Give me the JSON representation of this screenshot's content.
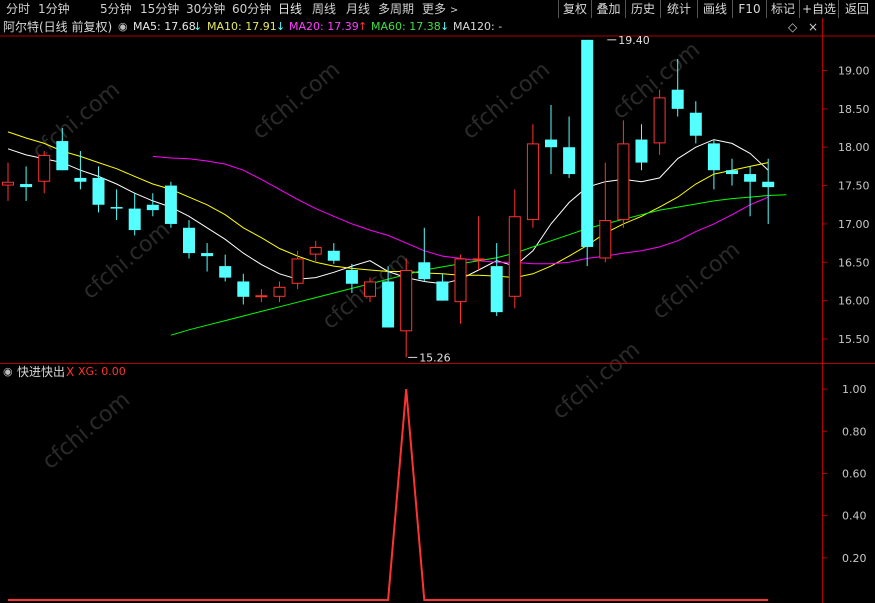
{
  "toolbar": {
    "periods": [
      "分时",
      "1分钟",
      "5分钟",
      "15分钟",
      "30分钟",
      "60分钟",
      "日线",
      "周线",
      "月线",
      "多周期",
      "更多"
    ],
    "right_buttons": [
      "复权",
      "叠加",
      "历史",
      "统计",
      "画线",
      "F10",
      "标记",
      "+自选",
      "返回"
    ]
  },
  "info": {
    "title": "阿尔特(日线 前复权)",
    "ma5": "MA5: 17.68",
    "ma10": "MA10: 17.91",
    "ma20": "MA20: 17.39",
    "ma60": "MA60: 17.38",
    "ma120": "MA120: -"
  },
  "indicator": {
    "name": "快进快出",
    "close_mark": "X",
    "value_label": "XG: 0.00"
  },
  "colors": {
    "up": "#ff3232",
    "down": "#54ffff",
    "ma5": "#ffffff",
    "ma10": "#ffff00",
    "ma20": "#ff00ff",
    "ma60": "#00ff00",
    "axis": "#b00000"
  },
  "watermark": "cfchi.com",
  "chart_data": [
    {
      "type": "candlestick",
      "title": "阿尔特(日线 前复权)",
      "ylim": [
        15.2,
        19.45
      ],
      "yticks": [
        "15.50",
        "16.00",
        "16.50",
        "17.00",
        "17.50",
        "18.00",
        "18.50",
        "19.00"
      ],
      "annotations": [
        {
          "text": "19.40",
          "candle": 33,
          "price": 19.4
        },
        {
          "text": "15.26",
          "candle": 22,
          "price": 15.26
        }
      ],
      "candles": [
        {
          "o": 17.5,
          "h": 17.8,
          "l": 17.3,
          "c": 17.55
        },
        {
          "o": 17.52,
          "h": 17.75,
          "l": 17.3,
          "c": 17.48
        },
        {
          "o": 17.55,
          "h": 17.95,
          "l": 17.4,
          "c": 17.9
        },
        {
          "o": 18.08,
          "h": 18.25,
          "l": 17.7,
          "c": 17.7
        },
        {
          "o": 17.6,
          "h": 17.95,
          "l": 17.45,
          "c": 17.55
        },
        {
          "o": 17.6,
          "h": 17.75,
          "l": 17.15,
          "c": 17.25
        },
        {
          "o": 17.22,
          "h": 17.45,
          "l": 17.05,
          "c": 17.2
        },
        {
          "o": 17.2,
          "h": 17.4,
          "l": 16.85,
          "c": 16.92
        },
        {
          "o": 17.25,
          "h": 17.4,
          "l": 17.1,
          "c": 17.18
        },
        {
          "o": 17.5,
          "h": 17.55,
          "l": 16.95,
          "c": 17.0
        },
        {
          "o": 16.95,
          "h": 17.05,
          "l": 16.55,
          "c": 16.62
        },
        {
          "o": 16.62,
          "h": 16.75,
          "l": 16.38,
          "c": 16.58
        },
        {
          "o": 16.45,
          "h": 16.6,
          "l": 16.25,
          "c": 16.3
        },
        {
          "o": 16.25,
          "h": 16.35,
          "l": 15.95,
          "c": 16.05
        },
        {
          "o": 16.05,
          "h": 16.15,
          "l": 15.98,
          "c": 16.07
        },
        {
          "o": 16.05,
          "h": 16.25,
          "l": 15.98,
          "c": 16.18
        },
        {
          "o": 16.22,
          "h": 16.65,
          "l": 16.15,
          "c": 16.55
        },
        {
          "o": 16.6,
          "h": 16.78,
          "l": 16.5,
          "c": 16.7
        },
        {
          "o": 16.65,
          "h": 16.75,
          "l": 16.48,
          "c": 16.52
        },
        {
          "o": 16.4,
          "h": 16.48,
          "l": 16.1,
          "c": 16.22
        },
        {
          "o": 16.05,
          "h": 16.3,
          "l": 15.98,
          "c": 16.25
        },
        {
          "o": 16.25,
          "h": 16.45,
          "l": 15.65,
          "c": 15.65
        },
        {
          "o": 15.6,
          "h": 16.55,
          "l": 15.26,
          "c": 16.4
        },
        {
          "o": 16.5,
          "h": 16.95,
          "l": 16.25,
          "c": 16.28
        },
        {
          "o": 16.25,
          "h": 16.35,
          "l": 16.0,
          "c": 16.0
        },
        {
          "o": 15.98,
          "h": 16.6,
          "l": 15.7,
          "c": 16.55
        },
        {
          "o": 16.55,
          "h": 17.1,
          "l": 16.4,
          "c": 16.55
        },
        {
          "o": 16.45,
          "h": 16.75,
          "l": 15.8,
          "c": 15.85
        },
        {
          "o": 16.05,
          "h": 17.45,
          "l": 15.9,
          "c": 17.1
        },
        {
          "o": 17.05,
          "h": 18.3,
          "l": 16.95,
          "c": 18.05
        },
        {
          "o": 18.1,
          "h": 18.55,
          "l": 17.65,
          "c": 18.0
        },
        {
          "o": 18.0,
          "h": 18.4,
          "l": 17.6,
          "c": 17.65
        },
        {
          "o": 19.4,
          "h": 19.4,
          "l": 16.45,
          "c": 16.7
        },
        {
          "o": 16.55,
          "h": 17.8,
          "l": 16.5,
          "c": 17.05
        },
        {
          "o": 17.05,
          "h": 18.35,
          "l": 16.95,
          "c": 18.05
        },
        {
          "o": 18.1,
          "h": 18.3,
          "l": 17.7,
          "c": 17.8
        },
        {
          "o": 18.05,
          "h": 18.75,
          "l": 17.9,
          "c": 18.65
        },
        {
          "o": 18.75,
          "h": 19.15,
          "l": 18.4,
          "c": 18.5
        },
        {
          "o": 18.45,
          "h": 18.6,
          "l": 18.05,
          "c": 18.15
        },
        {
          "o": 18.05,
          "h": 18.1,
          "l": 17.45,
          "c": 17.7
        },
        {
          "o": 17.7,
          "h": 17.85,
          "l": 17.5,
          "c": 17.65
        },
        {
          "o": 17.65,
          "h": 17.75,
          "l": 17.1,
          "c": 17.55
        },
        {
          "o": 17.55,
          "h": 17.85,
          "l": 17.0,
          "c": 17.48
        }
      ],
      "series": [
        {
          "name": "MA5",
          "from": 0,
          "values": [
            17.98,
            17.9,
            17.85,
            17.8,
            17.7,
            17.62,
            17.52,
            17.4,
            17.3,
            17.22,
            17.1,
            16.95,
            16.8,
            16.62,
            16.47,
            16.35,
            16.28,
            16.3,
            16.37,
            16.45,
            16.52,
            16.38,
            16.3,
            16.25,
            16.22,
            16.28,
            16.4,
            16.52,
            16.45,
            16.65,
            17.0,
            17.28,
            17.48,
            17.55,
            17.58,
            17.55,
            17.6,
            17.85,
            18.0,
            18.1,
            18.05,
            17.92,
            17.7
          ]
        },
        {
          "name": "MA10",
          "from": 0,
          "values": [
            18.2,
            18.12,
            18.05,
            17.95,
            17.88,
            17.8,
            17.72,
            17.62,
            17.52,
            17.45,
            17.35,
            17.25,
            17.12,
            16.95,
            16.82,
            16.68,
            16.58,
            16.5,
            16.45,
            16.42,
            16.4,
            16.38,
            16.38,
            16.36,
            16.35,
            16.33,
            16.33,
            16.32,
            16.3,
            16.35,
            16.45,
            16.58,
            16.72,
            16.88,
            17.0,
            17.1,
            17.22,
            17.35,
            17.52,
            17.65,
            17.7,
            17.75,
            17.8
          ]
        },
        {
          "name": "MA20",
          "from": 8,
          "values": [
            17.88,
            17.86,
            17.85,
            17.82,
            17.78,
            17.7,
            17.58,
            17.45,
            17.32,
            17.2,
            17.1,
            17.0,
            16.92,
            16.85,
            16.75,
            16.65,
            16.58,
            16.55,
            16.52,
            16.5,
            16.5,
            16.48,
            16.48,
            16.5,
            16.55,
            16.58,
            16.62,
            16.65,
            16.7,
            16.78,
            16.9,
            17.0,
            17.12,
            17.25,
            17.35
          ]
        },
        {
          "name": "MA60",
          "from": 9,
          "values": [
            15.55,
            15.62,
            15.68,
            15.74,
            15.8,
            15.86,
            15.92,
            15.98,
            16.04,
            16.1,
            16.16,
            16.22,
            16.28,
            16.34,
            16.4,
            16.44,
            16.48,
            16.52,
            16.56,
            16.62,
            16.7,
            16.78,
            16.86,
            16.94,
            17.0,
            17.06,
            17.12,
            17.18,
            17.22,
            17.26,
            17.3,
            17.33,
            17.35,
            17.37,
            17.38
          ]
        }
      ]
    },
    {
      "type": "line",
      "title": "快进快出",
      "series": [
        {
          "name": "XG",
          "values": [
            0,
            0,
            0,
            0,
            0,
            0,
            0,
            0,
            0,
            0,
            0,
            0,
            0,
            0,
            0,
            0,
            0,
            0,
            0,
            0,
            0,
            0,
            1,
            0,
            0,
            0,
            0,
            0,
            0,
            0,
            0,
            0,
            0,
            0,
            0,
            0,
            0,
            0,
            0,
            0,
            0,
            0,
            0
          ]
        }
      ],
      "ylim": [
        0,
        1.1
      ],
      "yticks": [
        "0.20",
        "0.40",
        "0.60",
        "0.80",
        "1.00"
      ]
    }
  ]
}
